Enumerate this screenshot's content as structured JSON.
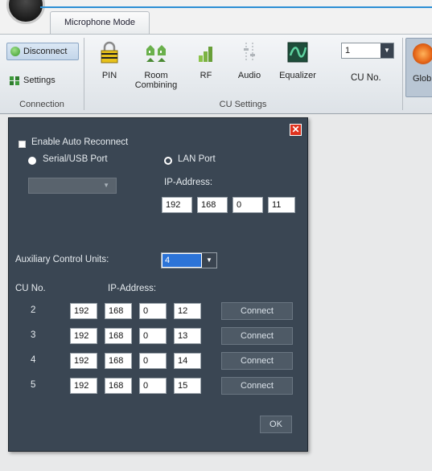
{
  "tab": {
    "label": "Microphone Mode"
  },
  "ribbon": {
    "connection": {
      "disconnect": "Disconnect",
      "settings": "Settings",
      "group_label": "Connection"
    },
    "cu_settings": {
      "pin": "PIN",
      "room_combining_1": "Room",
      "room_combining_2": "Combining",
      "rf": "RF",
      "audio": "Audio",
      "equalizer": "Equalizer",
      "cu_no_value": "1",
      "cu_no_label": "CU No.",
      "group_label": "CU Settings"
    },
    "global_label": "Glob"
  },
  "dialog": {
    "enable_auto_reconnect": "Enable Auto Reconnect",
    "serial_usb_port": "Serial/USB Port",
    "lan_port": "LAN Port",
    "ip_address_label": "IP-Address:",
    "main_ip": [
      "192",
      "168",
      "0",
      "11"
    ],
    "aux_label": "Auxiliary Control Units:",
    "aux_count": "4",
    "cu_no_header": "CU No.",
    "ip_header": "IP-Address:",
    "rows": [
      {
        "cu": "2",
        "ip": [
          "192",
          "168",
          "0",
          "12"
        ],
        "action": "Connect"
      },
      {
        "cu": "3",
        "ip": [
          "192",
          "168",
          "0",
          "13"
        ],
        "action": "Connect"
      },
      {
        "cu": "4",
        "ip": [
          "192",
          "168",
          "0",
          "14"
        ],
        "action": "Connect"
      },
      {
        "cu": "5",
        "ip": [
          "192",
          "168",
          "0",
          "15"
        ],
        "action": "Connect"
      }
    ],
    "ok": "OK",
    "close": "✕"
  },
  "colors": {
    "dialog_bg": "#3a4653",
    "accent": "#2d8fd5",
    "close_red": "#e0321e",
    "selected_blue": "#2c74d8"
  }
}
